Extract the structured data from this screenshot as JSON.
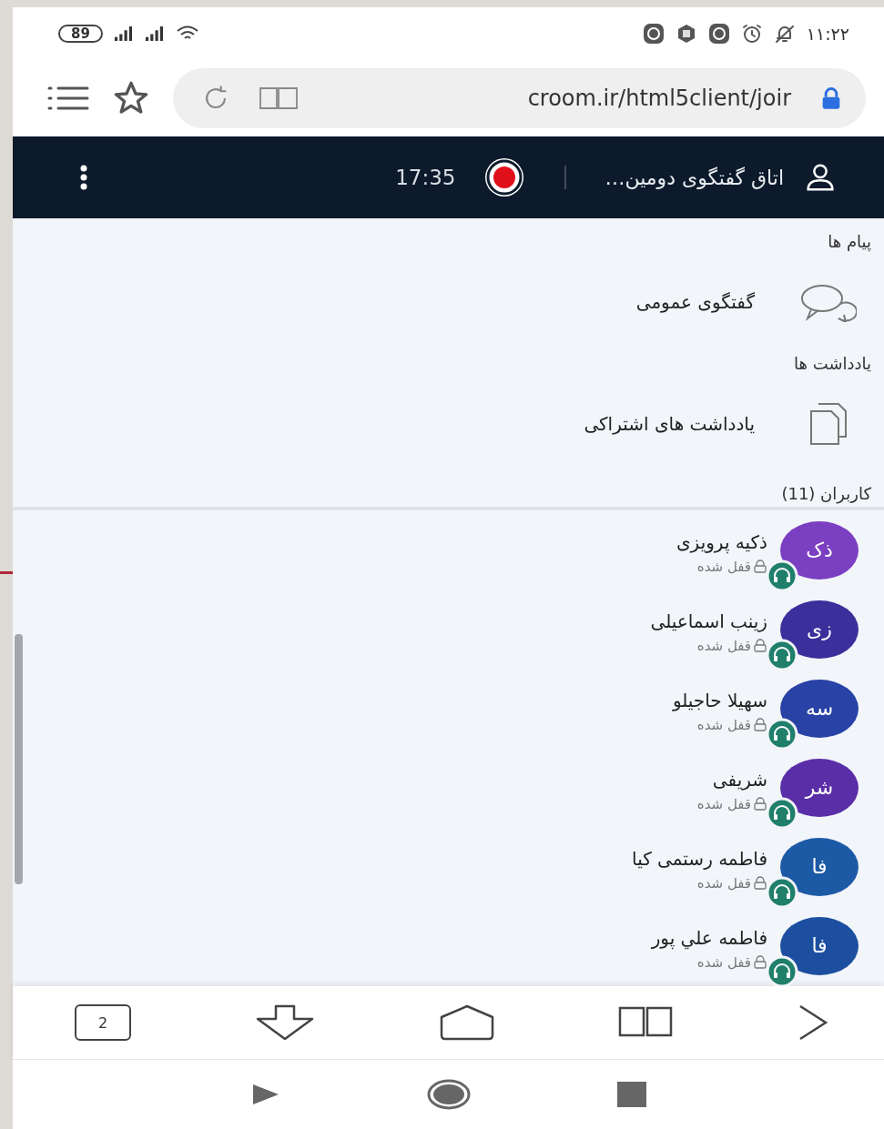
{
  "status_bar": {
    "battery": "89",
    "time": "۱۱:۲۲"
  },
  "browser": {
    "url": "croom.ir/html5client/joir",
    "tab_count": "2"
  },
  "header": {
    "title": "اتاق گفتگوی دومین…",
    "recording": true,
    "elapsed": "17:35"
  },
  "sections": [
    {
      "heading": "پیام ها",
      "items": [
        {
          "kind": "chat",
          "label": "گفتگوی عمومی"
        }
      ]
    },
    {
      "heading": "یادداشت ها",
      "items": [
        {
          "kind": "notes",
          "label": "یادداشت های اشتراکی"
        }
      ]
    }
  ],
  "users": {
    "heading": "کاربران (11)",
    "list": [
      {
        "initials": "ذک",
        "name": "ذکیه پرویزی",
        "status": "قفل شده",
        "color": "#7b3fc2"
      },
      {
        "initials": "زی",
        "name": "زینب اسماعیلی",
        "status": "قفل شده",
        "color": "#3b2f9c"
      },
      {
        "initials": "سه",
        "name": "سهیلا حاجیلو",
        "status": "قفل شده",
        "color": "#2842a6"
      },
      {
        "initials": "شر",
        "name": "شریفی",
        "status": "قفل شده",
        "color": "#5a2ea6"
      },
      {
        "initials": "فا",
        "name": "فاطمه رستمی کیا",
        "status": "قفل شده",
        "color": "#1d5aa6"
      },
      {
        "initials": "فا",
        "name": "فاطمه علي پور",
        "status": "قفل شده",
        "color": "#1c4fa0"
      }
    ]
  }
}
